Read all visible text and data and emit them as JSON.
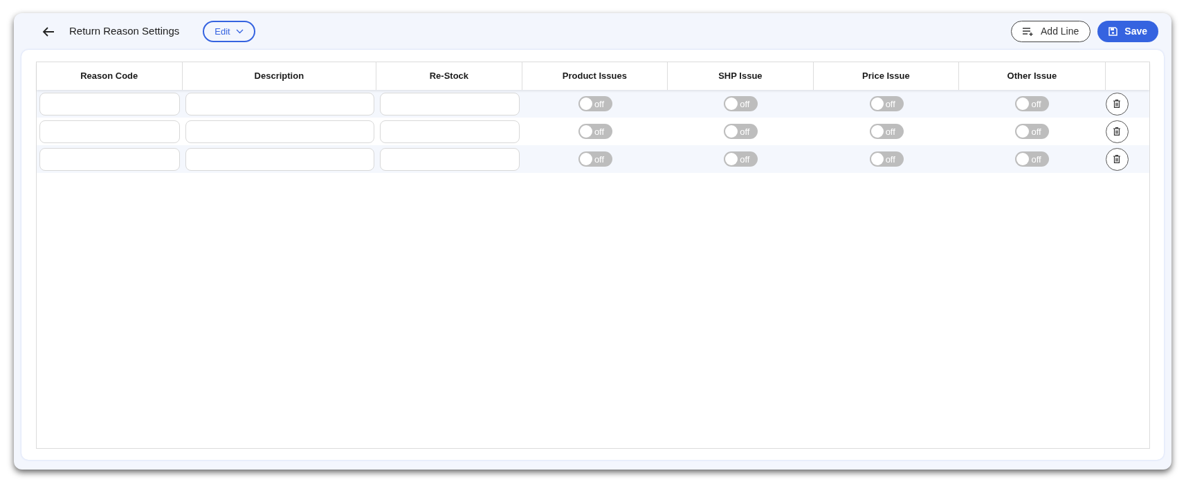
{
  "header": {
    "title": "Return Reason Settings",
    "mode_button": "Edit",
    "actions": [
      {
        "kind": "add",
        "label": "Add Line"
      },
      {
        "kind": "save",
        "label": "Save"
      }
    ]
  },
  "table": {
    "columns": [
      {
        "label": "Reason Code",
        "kind": "text"
      },
      {
        "label": "Description",
        "kind": "text"
      },
      {
        "label": "Re-Stock",
        "kind": "text"
      },
      {
        "label": "Product Issues",
        "kind": "toggle"
      },
      {
        "label": "SHP Issue",
        "kind": "toggle"
      },
      {
        "label": "Price Issue",
        "kind": "toggle"
      },
      {
        "label": "Other Issue",
        "kind": "toggle"
      },
      {
        "kind": "action"
      }
    ],
    "rows": [
      {
        "toggles": [
          {
            "on": false,
            "label": "off"
          },
          {
            "on": false,
            "label": "off"
          },
          {
            "on": false,
            "label": "off"
          },
          {
            "on": false,
            "label": "off"
          }
        ]
      },
      {
        "toggles": [
          {
            "on": false,
            "label": "off"
          },
          {
            "on": false,
            "label": "off"
          },
          {
            "on": false,
            "label": "off"
          },
          {
            "on": false,
            "label": "off"
          }
        ]
      },
      {
        "toggles": [
          {
            "on": false,
            "label": "off"
          },
          {
            "on": false,
            "label": "off"
          },
          {
            "on": false,
            "label": "off"
          },
          {
            "on": false,
            "label": "off"
          }
        ]
      }
    ]
  }
}
